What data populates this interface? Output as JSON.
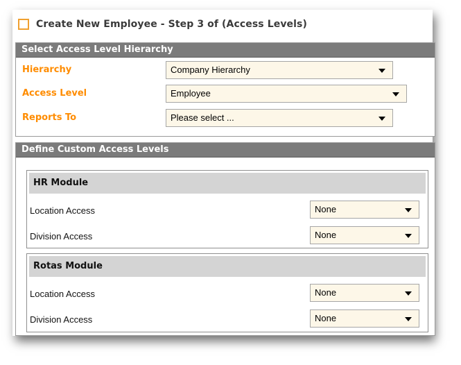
{
  "page": {
    "title": "Create New Employee - Step 3 of (Access Levels)"
  },
  "hierarchy_section": {
    "header": "Select Access Level Hierarchy",
    "fields": [
      {
        "label": "Hierarchy",
        "value": "Company Hierarchy"
      },
      {
        "label": "Access Level",
        "value": "Employee"
      },
      {
        "label": "Reports To",
        "value": "Please select ..."
      }
    ]
  },
  "custom_section": {
    "header": "Define Custom Access Levels",
    "modules": [
      {
        "name": "HR Module",
        "rows": [
          {
            "label": "Location Access",
            "value": "None"
          },
          {
            "label": "Division Access",
            "value": "None"
          }
        ]
      },
      {
        "name": "Rotas Module",
        "rows": [
          {
            "label": "Location Access",
            "value": "None"
          },
          {
            "label": "Division Access",
            "value": "None"
          }
        ]
      }
    ]
  },
  "colors": {
    "accent": "#ff8c00",
    "header_bg": "#7b7b7b",
    "module_header_bg": "#d4d4d4",
    "select_bg": "#fdf7e8"
  },
  "icons": {
    "title": "orange-square-icon",
    "dropdown": "chevron-down-icon"
  }
}
